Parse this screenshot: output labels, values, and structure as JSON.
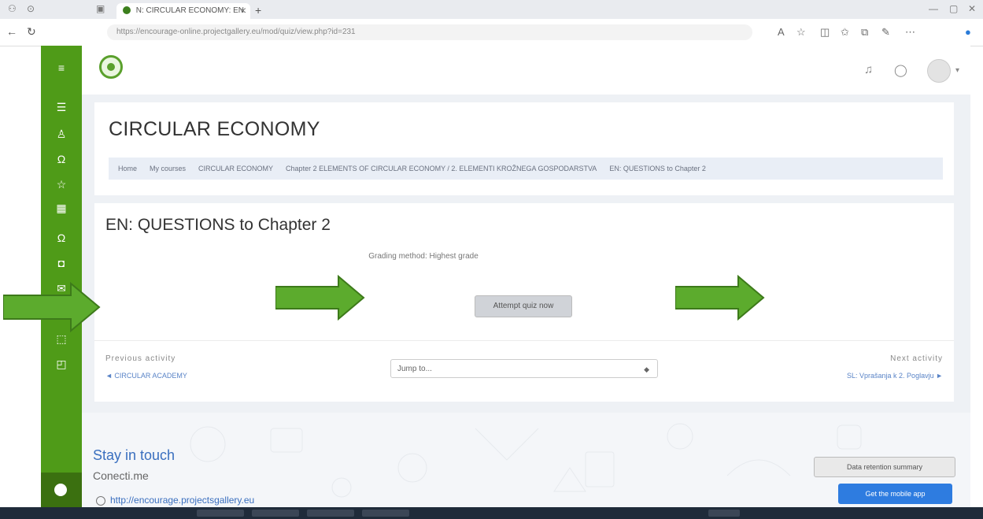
{
  "browser": {
    "tab_title": "N: CIRCULAR ECONOMY: EN: QUESTI",
    "url": "https://encourage-online.projectgallery.eu/mod/quiz/view.php?id=231",
    "new_tab": "+",
    "close_tab": "×"
  },
  "colors": {
    "sidebar": "#4f9b18",
    "link": "#5a84c7",
    "primary_button": "#2e7ce0",
    "arrow": "#5cab2d"
  },
  "sidebar": {
    "icons": [
      "hamburger-icon",
      "list-icon",
      "user-icon",
      "headphones-icon",
      "star-icon",
      "calendar-icon",
      "headphones-icon",
      "screen-icon",
      "mail-icon",
      "layers-icon",
      "box-icon"
    ]
  },
  "course": {
    "title": "CIRCULAR ECONOMY",
    "breadcrumb": [
      "Home",
      "My courses",
      "CIRCULAR ECONOMY",
      "Chapter 2 ELEMENTS OF CIRCULAR ECONOMY / 2. ELEMENTI KROŽNEGA GOSPODARSTVA",
      "EN: QUESTIONS to Chapter 2"
    ]
  },
  "quiz": {
    "title": "EN: QUESTIONS to Chapter 2",
    "grading": "Grading method: Highest grade",
    "attempt_button": "Attempt quiz now"
  },
  "navigation": {
    "previous_label": "Previous activity",
    "previous_link": "◄ CIRCULAR ACADEMY",
    "jump_placeholder": "Jump to...",
    "next_label": "Next activity",
    "next_link": "SL: Vprašanja k 2. Poglavju ►"
  },
  "footer": {
    "stay_in_touch": "Stay in touch",
    "connect": "Conecti.me",
    "site_link": "http://encourage.projectsgallery.eu",
    "data_summary": "Data retention summary",
    "mobile_app": "Get the mobile app"
  }
}
